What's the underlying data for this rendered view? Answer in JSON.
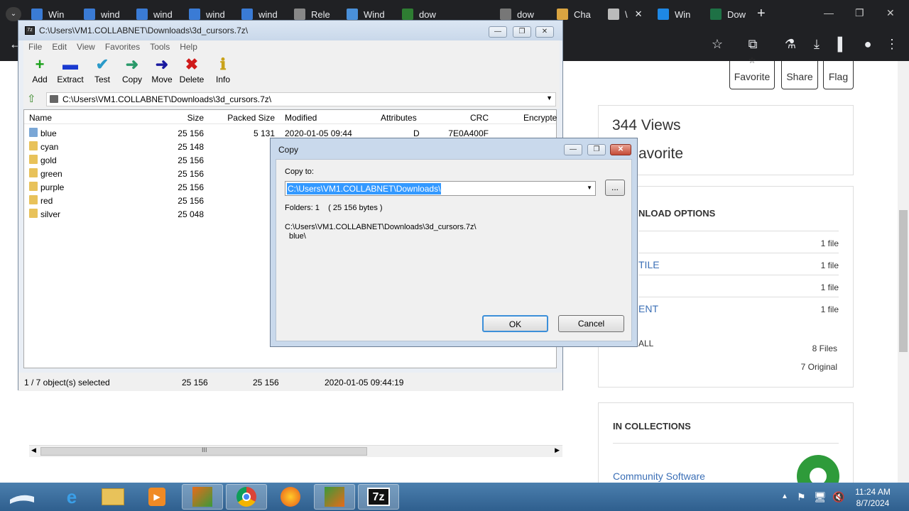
{
  "browser": {
    "tabs": [
      {
        "label": "Win",
        "fav": "#3a7bd5"
      },
      {
        "label": "wind",
        "fav": "#3a7bd5"
      },
      {
        "label": "wind",
        "fav": "#3a7bd5"
      },
      {
        "label": "wind",
        "fav": "#3a7bd5"
      },
      {
        "label": "wind",
        "fav": "#3a7bd5"
      },
      {
        "label": "Rele",
        "fav": "#888888"
      },
      {
        "label": "Wind",
        "fav": "#4a90d9"
      },
      {
        "label": "dow",
        "fav": "#2e7d32"
      },
      {
        "label": "dow",
        "fav": "#777777"
      },
      {
        "label": "Cha",
        "fav": "#d9a441"
      },
      {
        "label": "\\",
        "fav": "#bbbbbb",
        "close": "✕"
      },
      {
        "label": "Win",
        "fav": "#1e88e5"
      },
      {
        "label": "Dow",
        "fav": "#1e7145"
      }
    ],
    "newtab": "+",
    "toolbar_icons": [
      "star-icon",
      "extensions-icon",
      "labs-icon",
      "download-icon",
      "sidepanel-icon",
      "profile-icon",
      "menu-icon"
    ]
  },
  "webpage": {
    "favorite_label": "Favorite",
    "share_label": "Share",
    "flag_label": "Flag",
    "views": "344 Views",
    "favorite_count": "avorite",
    "download_options_title": "NLOAD OPTIONS",
    "options": [
      {
        "label": "",
        "count": "1 file"
      },
      {
        "label": "TILE",
        "count": "1 file"
      },
      {
        "label": "",
        "count": "1 file"
      },
      {
        "label": "ENT",
        "count": "1 file"
      }
    ],
    "all_label": "ALL",
    "files_count": "8 Files",
    "original_count": "7 Original",
    "collections_title": "IN COLLECTIONS",
    "collection_link": "Community Software"
  },
  "zip": {
    "title": "C:\\Users\\VM1.COLLABNET\\Downloads\\3d_cursors.7z\\",
    "menu": [
      "File",
      "Edit",
      "View",
      "Favorites",
      "Tools",
      "Help"
    ],
    "tools": [
      {
        "label": "Add",
        "icon": "+",
        "color": "#1aa01a"
      },
      {
        "label": "Extract",
        "icon": "▬",
        "color": "#1a3ad0"
      },
      {
        "label": "Test",
        "icon": "✔",
        "color": "#2a9ac9"
      },
      {
        "label": "Copy",
        "icon": "➜",
        "color": "#2a9a6a"
      },
      {
        "label": "Move",
        "icon": "➜",
        "color": "#1a1aa0"
      },
      {
        "label": "Delete",
        "icon": "✖",
        "color": "#d01a1a"
      },
      {
        "label": "Info",
        "icon": "ℹ",
        "color": "#c9a21a"
      }
    ],
    "address": "C:\\Users\\VM1.COLLABNET\\Downloads\\3d_cursors.7z\\",
    "columns": [
      "Name",
      "Size",
      "Packed Size",
      "Modified",
      "Attributes",
      "CRC",
      "Encrypte"
    ],
    "rows": [
      {
        "name": "blue",
        "size": "25 156",
        "packed": "5 131",
        "modified": "2020-01-05 09:44",
        "attr": "D",
        "crc": "7E0A400F"
      },
      {
        "name": "cyan",
        "size": "25 148",
        "packed": "",
        "modified": "",
        "attr": "",
        "crc": ""
      },
      {
        "name": "gold",
        "size": "25 156",
        "packed": "",
        "modified": "",
        "attr": "",
        "crc": ""
      },
      {
        "name": "green",
        "size": "25 156",
        "packed": "",
        "modified": "",
        "attr": "",
        "crc": ""
      },
      {
        "name": "purple",
        "size": "25 156",
        "packed": "",
        "modified": "",
        "attr": "",
        "crc": ""
      },
      {
        "name": "red",
        "size": "25 156",
        "packed": "",
        "modified": "",
        "attr": "",
        "crc": ""
      },
      {
        "name": "silver",
        "size": "25 048",
        "packed": "",
        "modified": "",
        "attr": "",
        "crc": ""
      }
    ],
    "status": {
      "selected": "1 / 7 object(s) selected",
      "size": "25 156",
      "packed": "25 156",
      "modified": "2020-01-05 09:44:19"
    },
    "scroll_mark": "III"
  },
  "dialog": {
    "title": "Copy",
    "copy_to_label": "Copy to:",
    "path": "C:\\Users\\VM1.COLLABNET\\Downloads\\",
    "browse_label": "...",
    "folders_info": "Folders: 1    ( 25 156 bytes )",
    "source_line1": "C:\\Users\\VM1.COLLABNET\\Downloads\\3d_cursors.7z\\",
    "source_line2": "blue\\",
    "ok_label": "OK",
    "cancel_label": "Cancel"
  },
  "taskbar": {
    "time": "11:24 AM",
    "date": "8/7/2024",
    "zip_label": "7z"
  }
}
